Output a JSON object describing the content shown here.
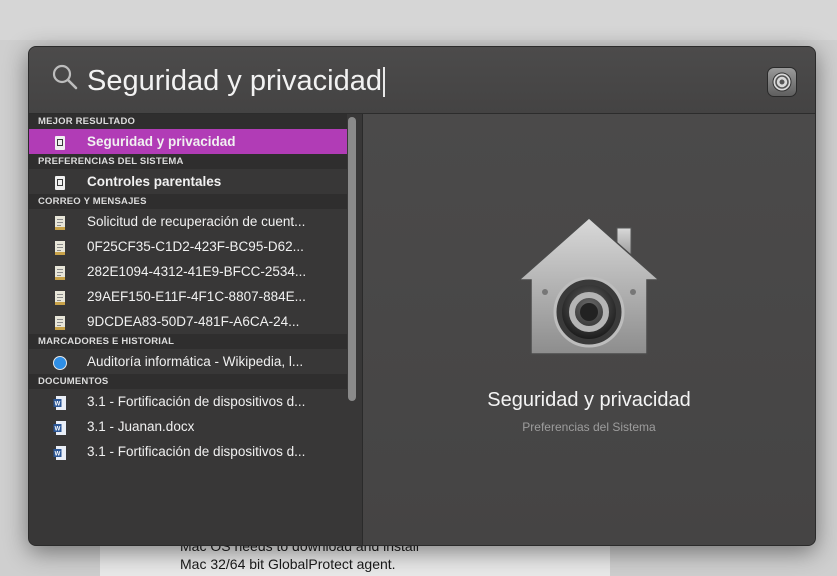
{
  "background_doc": {
    "line1": "Mac OS needs to download and install",
    "line2": "Mac 32/64 bit GlobalProtect agent."
  },
  "search": {
    "query": "Seguridad y privacidad",
    "icon": "search-icon",
    "sysprefs_icon": "system-preferences-icon"
  },
  "results": {
    "sections": [
      {
        "header": "MEJOR RESULTADO",
        "items": [
          {
            "label": "Seguridad y privacidad",
            "icon": "preference-pane-icon",
            "selected": true
          }
        ]
      },
      {
        "header": "PREFERENCIAS DEL SISTEMA",
        "items": [
          {
            "label": "Controles parentales",
            "icon": "preference-pane-icon"
          }
        ]
      },
      {
        "header": "CORREO Y MENSAJES",
        "items": [
          {
            "label": "Solicitud de recuperación de cuent...",
            "icon": "mail-document-icon"
          },
          {
            "label": "0F25CF35-C1D2-423F-BC95-D62...",
            "icon": "mail-document-icon"
          },
          {
            "label": "282E1094-4312-41E9-BFCC-2534...",
            "icon": "mail-document-icon"
          },
          {
            "label": "29AEF150-E11F-4F1C-8807-884E...",
            "icon": "mail-document-icon"
          },
          {
            "label": "9DCDEA83-50D7-481F-A6CA-24...",
            "icon": "mail-document-icon"
          }
        ]
      },
      {
        "header": "MARCADORES E HISTORIAL",
        "items": [
          {
            "label": "Auditoría informática - Wikipedia, l...",
            "icon": "safari-compass-icon"
          }
        ]
      },
      {
        "header": "DOCUMENTOS",
        "items": [
          {
            "label": "3.1 - Fortificación de dispositivos d...",
            "icon": "word-document-icon"
          },
          {
            "label": "3.1 - Juanan.docx",
            "icon": "word-document-icon"
          },
          {
            "label": "3.1 - Fortificación de dispositivos d...",
            "icon": "word-document-icon"
          }
        ]
      }
    ]
  },
  "preview": {
    "title": "Seguridad y privacidad",
    "subtitle": "Preferencias del Sistema",
    "icon": "security-house-lock-icon"
  },
  "colors": {
    "selection": "#b13cb6",
    "panel": "#3e3d3d"
  }
}
